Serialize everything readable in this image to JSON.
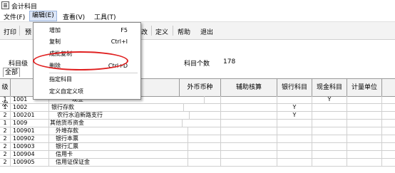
{
  "window": {
    "title": "会计科目"
  },
  "menubar": [
    "文件(F)",
    "编辑(E)",
    "查看(V)",
    "工具(T)"
  ],
  "toolbar": [
    "打印",
    "预",
    "改",
    "定义",
    "帮助",
    "退出"
  ],
  "form": {
    "level_label": "科目级",
    "count_label": "科目个数",
    "count_value": "178",
    "tab": "全部",
    "index_label": "级次"
  },
  "dropdown": {
    "items": [
      {
        "label": "增加",
        "shortcut": "F5"
      },
      {
        "label": "复制",
        "shortcut": "Ctrl+I"
      },
      {
        "label": "成批复制",
        "shortcut": ""
      },
      {
        "label": "删除",
        "shortcut": "Ctrl+D"
      },
      {
        "label": "指定科目",
        "shortcut": ""
      },
      {
        "label": "定义自定义项",
        "shortcut": ""
      }
    ]
  },
  "table": {
    "headers": [
      "外币币种",
      "辅助核算",
      "银行科目",
      "现金科目",
      "计量单位"
    ],
    "rows": [
      {
        "level": "1",
        "code": "1001",
        "name": "现金",
        "bank": "",
        "cash": "Y"
      },
      {
        "level": "1",
        "code": "1002",
        "name": "银行存款",
        "bank": "Y",
        "cash": ""
      },
      {
        "level": "2",
        "code": "100201",
        "name": "农行水泊新路支行",
        "bank": "Y",
        "cash": ""
      },
      {
        "level": "1",
        "code": "1009",
        "name": "其他货币资金",
        "bank": "",
        "cash": ""
      },
      {
        "level": "2",
        "code": "100901",
        "name": "外埠存款",
        "bank": "",
        "cash": ""
      },
      {
        "level": "2",
        "code": "100902",
        "name": "银行本票",
        "bank": "",
        "cash": ""
      },
      {
        "level": "2",
        "code": "100903",
        "name": "银行汇票",
        "bank": "",
        "cash": ""
      },
      {
        "level": "2",
        "code": "100904",
        "name": "信用卡",
        "bank": "",
        "cash": ""
      },
      {
        "level": "2",
        "code": "100905",
        "name": "信用证保证金",
        "bank": "",
        "cash": ""
      }
    ]
  }
}
